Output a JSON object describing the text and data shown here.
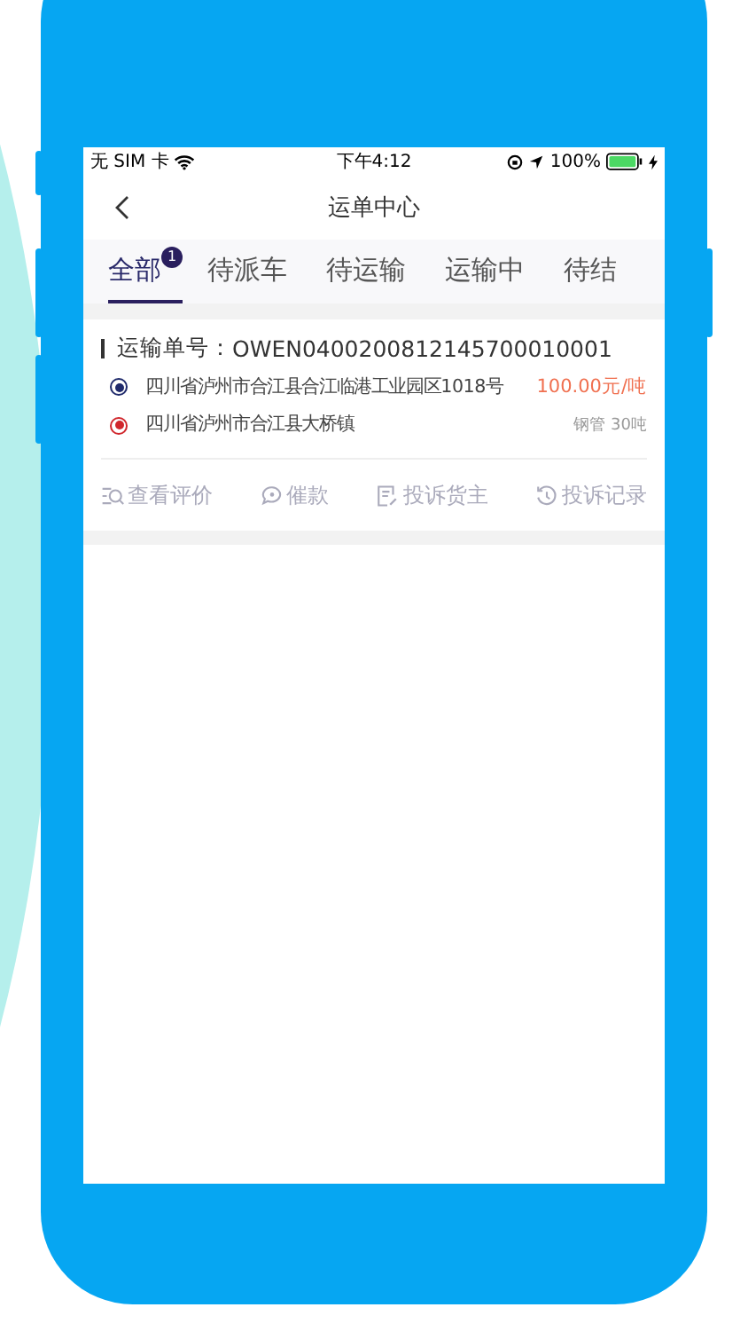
{
  "status_bar": {
    "carrier": "无 SIM 卡",
    "time": "下午4:12",
    "battery": "100%",
    "charging": true
  },
  "nav": {
    "title": "运单中心"
  },
  "tabs": [
    {
      "label": "全部",
      "selected": true,
      "badge": "1"
    },
    {
      "label": "待派车",
      "selected": false
    },
    {
      "label": "待运输",
      "selected": false
    },
    {
      "label": "运输中",
      "selected": false
    },
    {
      "label": "待结",
      "selected": false
    }
  ],
  "order": {
    "number_label": "运输单号：",
    "number": "OWEN0400200812145700010001",
    "stops": [
      {
        "kind": "origin",
        "address": "四川省泸州市合江县合江临港工业园区1018号",
        "color": "#1f2a6b",
        "note": "100.00元/吨"
      },
      {
        "kind": "destination",
        "address": "四川省泸州市合江县大桥镇",
        "color": "#d0262c",
        "note": "钢管 30吨"
      }
    ],
    "actions": [
      {
        "kind": "review",
        "label": "查看评价"
      },
      {
        "kind": "remind",
        "label": "催款"
      },
      {
        "kind": "complain",
        "label": "投诉货主"
      },
      {
        "kind": "history",
        "label": "投诉记录"
      }
    ]
  }
}
